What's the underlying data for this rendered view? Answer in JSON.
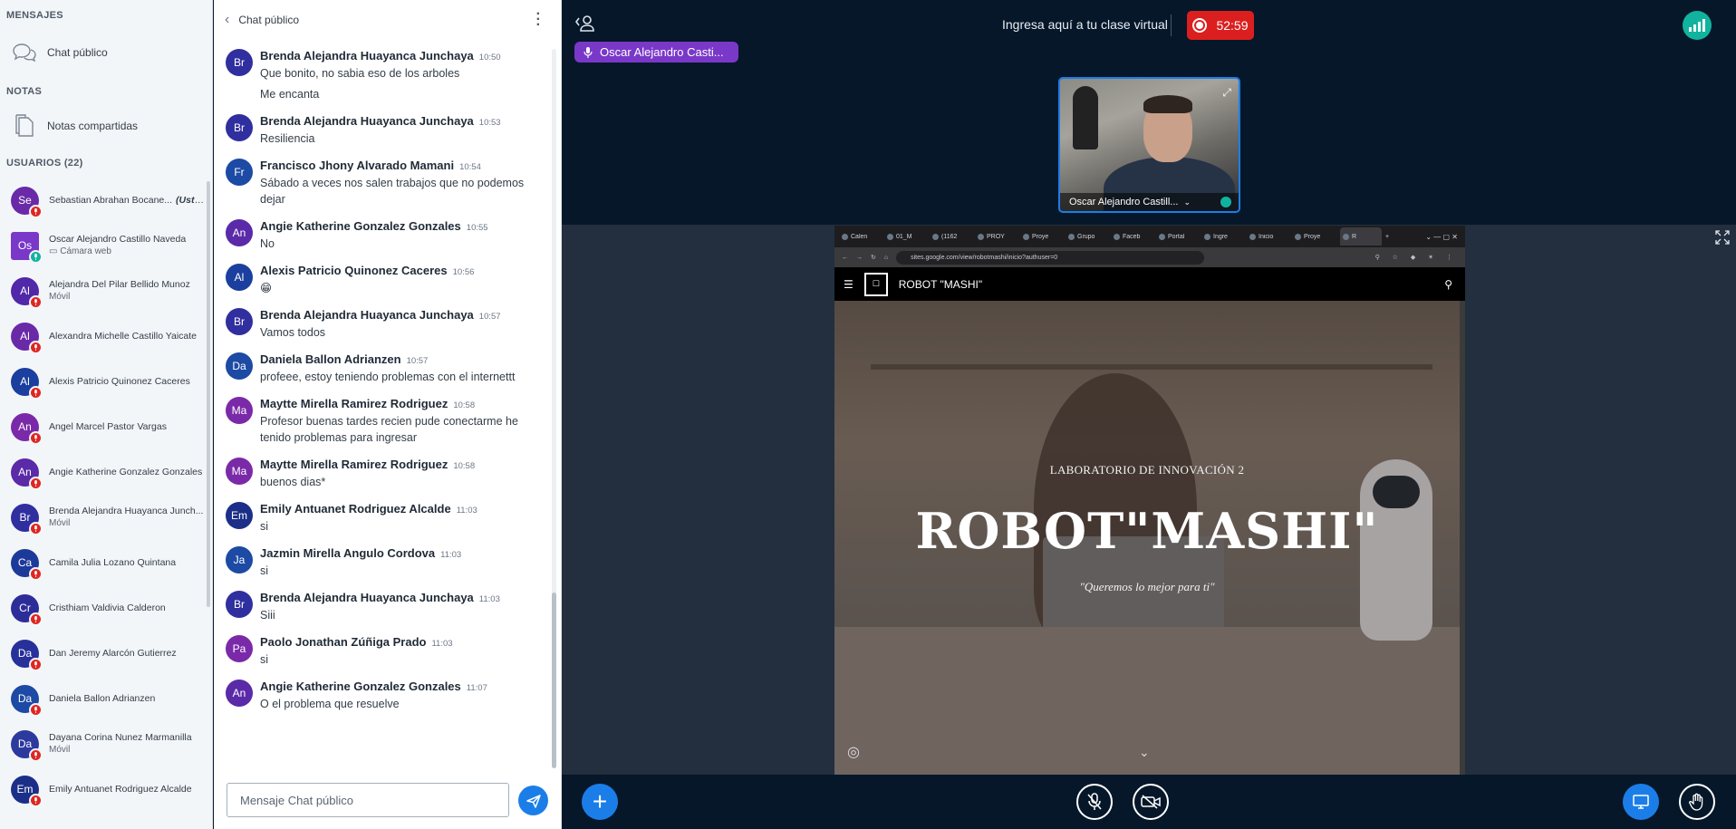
{
  "sidebar": {
    "messages_title": "MENSAJES",
    "public_chat_label": "Chat público",
    "notes_title": "NOTAS",
    "shared_notes_label": "Notas compartidas",
    "users_title": "USUARIOS (22)",
    "users": [
      {
        "initials": "Se",
        "name": "Sebastian Abrahan Bocane...",
        "you": "(Usted)",
        "sub": "",
        "color": "#6a2aa8"
      },
      {
        "initials": "Os",
        "name": "Oscar Alejandro Castillo Naveda",
        "you": "",
        "sub": "▭ Cámara web",
        "color": "#7a38c9"
      },
      {
        "initials": "Al",
        "name": "Alejandra Del Pilar Bellido Munoz",
        "you": "",
        "sub": "Móvil",
        "color": "#5128a8"
      },
      {
        "initials": "Al",
        "name": "Alexandra Michelle Castillo Yaicate",
        "you": "",
        "sub": "",
        "color": "#6a2aa8"
      },
      {
        "initials": "Al",
        "name": "Alexis Patricio Quinonez Caceres",
        "you": "",
        "sub": "",
        "color": "#1b3f9e"
      },
      {
        "initials": "An",
        "name": "Angel Marcel Pastor Vargas",
        "you": "",
        "sub": "",
        "color": "#7a2aa8"
      },
      {
        "initials": "An",
        "name": "Angie Katherine Gonzalez Gonzales",
        "you": "",
        "sub": "",
        "color": "#5a2aa8"
      },
      {
        "initials": "Br",
        "name": "Brenda Alejandra Huayanca Junch...",
        "you": "",
        "sub": "Móvil",
        "color": "#2f2fa0"
      },
      {
        "initials": "Ca",
        "name": "Camila Julia Lozano Quintana",
        "you": "",
        "sub": "",
        "color": "#1d3a9a"
      },
      {
        "initials": "Cr",
        "name": "Cristhiam Valdivia Calderon",
        "you": "",
        "sub": "",
        "color": "#2d2d9a"
      },
      {
        "initials": "Da",
        "name": "Dan Jeremy Alarcón Gutierrez",
        "you": "",
        "sub": "",
        "color": "#28309a"
      },
      {
        "initials": "Da",
        "name": "Daniela Ballon Adrianzen",
        "you": "",
        "sub": "",
        "color": "#1c4aa4"
      },
      {
        "initials": "Da",
        "name": "Dayana Corina Nunez Marmanilla",
        "you": "",
        "sub": "Móvil",
        "color": "#2c3a9e"
      },
      {
        "initials": "Em",
        "name": "Emily Antuanet Rodriguez Alcalde",
        "you": "",
        "sub": "",
        "color": "#1b2f88"
      }
    ]
  },
  "chat": {
    "title": "Chat público",
    "input_placeholder": "Mensaje Chat público",
    "messages": [
      {
        "initials": "Br",
        "color": "#2f2fa0",
        "name": "Brenda Alejandra Huayanca Junchaya",
        "time": "10:50",
        "lines": [
          "Que bonito, no sabia eso de los arboles",
          "Me encanta"
        ]
      },
      {
        "initials": "Br",
        "color": "#2f2fa0",
        "name": "Brenda Alejandra Huayanca Junchaya",
        "time": "10:53",
        "lines": [
          "Resiliencia"
        ]
      },
      {
        "initials": "Fr",
        "color": "#1c4aa4",
        "name": "Francisco Jhony Alvarado Mamani",
        "time": "10:54",
        "lines": [
          "Sábado a veces nos salen trabajos que no podemos dejar"
        ]
      },
      {
        "initials": "An",
        "color": "#5a2aa8",
        "name": "Angie Katherine Gonzalez Gonzales",
        "time": "10:55",
        "lines": [
          "No"
        ]
      },
      {
        "initials": "Al",
        "color": "#1b3f9e",
        "name": "Alexis Patricio Quinonez Caceres",
        "time": "10:56",
        "lines": [
          "😁"
        ]
      },
      {
        "initials": "Br",
        "color": "#2f2fa0",
        "name": "Brenda Alejandra Huayanca Junchaya",
        "time": "10:57",
        "lines": [
          "Vamos todos"
        ]
      },
      {
        "initials": "Da",
        "color": "#1c4aa4",
        "name": "Daniela Ballon Adrianzen",
        "time": "10:57",
        "lines": [
          "profeee, estoy teniendo problemas con el internettt"
        ]
      },
      {
        "initials": "Ma",
        "color": "#7a2aa8",
        "name": "Maytte Mirella Ramirez Rodriguez",
        "time": "10:58",
        "lines": [
          "Profesor buenas tardes recien pude conectarme he tenido problemas para ingresar"
        ]
      },
      {
        "initials": "Ma",
        "color": "#7a2aa8",
        "name": "Maytte Mirella Ramirez Rodriguez",
        "time": "10:58",
        "lines": [
          "buenos dias*"
        ]
      },
      {
        "initials": "Em",
        "color": "#1b2f88",
        "name": "Emily Antuanet Rodriguez Alcalde",
        "time": "11:03",
        "lines": [
          "si"
        ]
      },
      {
        "initials": "Ja",
        "color": "#1c4aa4",
        "name": "Jazmin Mirella Angulo Cordova",
        "time": "11:03",
        "lines": [
          "si"
        ]
      },
      {
        "initials": "Br",
        "color": "#2f2fa0",
        "name": "Brenda Alejandra Huayanca Junchaya",
        "time": "11:03",
        "lines": [
          "Siii"
        ]
      },
      {
        "initials": "Pa",
        "color": "#7a2aa8",
        "name": "Paolo Jonathan Zúñiga Prado",
        "time": "11:03",
        "lines": [
          "si"
        ]
      },
      {
        "initials": "An",
        "color": "#5a2aa8",
        "name": "Angie Katherine Gonzalez Gonzales",
        "time": "11:07",
        "lines": [
          "O el problema que resuelve"
        ]
      }
    ]
  },
  "main": {
    "meeting_title": "Ingresa aquí a tu clase virtual",
    "recording_time": "52:59",
    "talking_indicator": "Oscar Alejandro Casti...",
    "webcam_name": "Oscar Alejandro Castill...",
    "browser": {
      "tabs": [
        "Calen",
        "01_M",
        "(1162",
        "PROY",
        "Proye",
        "Grupo",
        "Faceb",
        "Portal",
        "Ingre",
        "Inicio",
        "Proye",
        "R"
      ],
      "url": "sites.google.com/view/robotmashi/inicio?authuser=0",
      "site_title": "ROBOT \"MASHI\"",
      "hero_kicker": "LABORATORIO DE INNOVACIÓN 2",
      "hero_title": "ROBOT\"MASHI\"",
      "hero_quote": "\"Queremos lo mejor para ti\""
    },
    "accent_color": "#1b7ee8",
    "record_color": "#db1f1f"
  }
}
